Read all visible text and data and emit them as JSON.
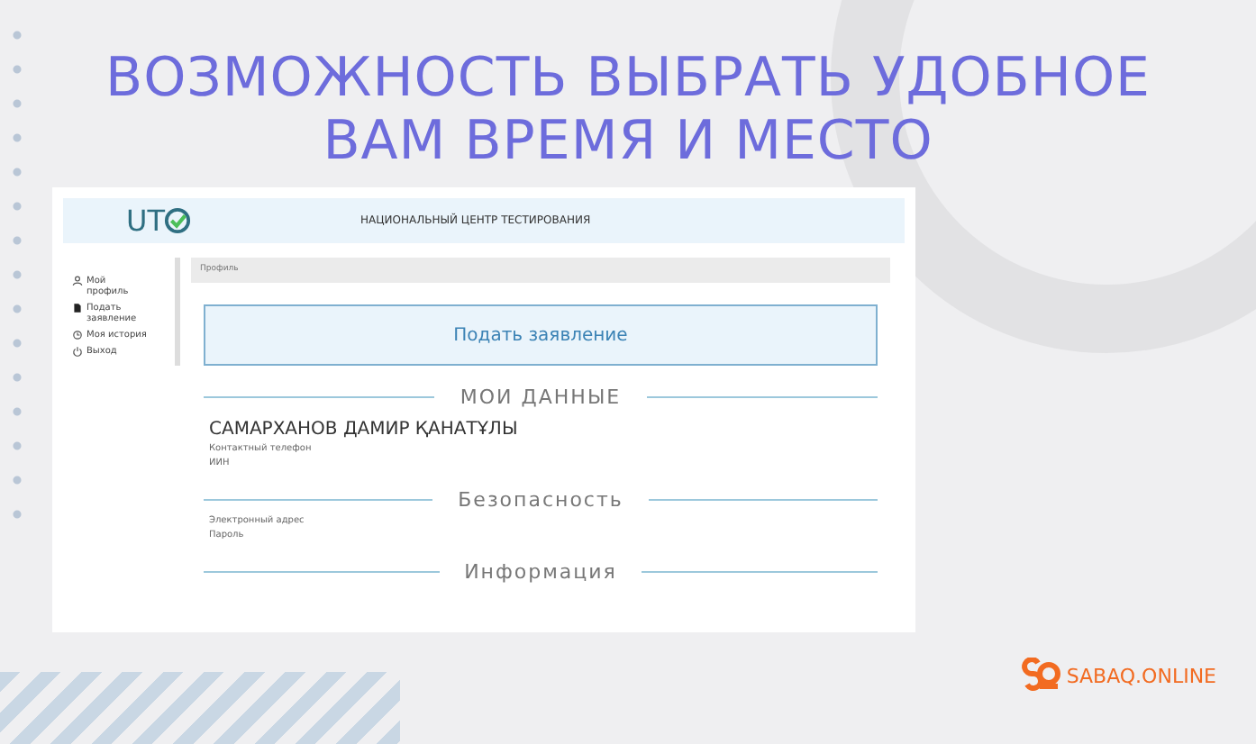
{
  "slide": {
    "title_lines": [
      "ВОЗМОЖНОСТЬ ВЫБРАТЬ УДОБНОЕ",
      "ВАМ ВРЕМЯ И МЕСТО"
    ]
  },
  "app": {
    "logo": "UT",
    "header_title": "НАЦИОНАЛЬНЫЙ ЦЕНТР ТЕСТИРОВАНИЯ",
    "sidebar": {
      "items": [
        {
          "kind": "profile",
          "label": "Мой профиль"
        },
        {
          "kind": "document",
          "label": "Подать заявление"
        },
        {
          "kind": "history",
          "label": "Моя история"
        },
        {
          "kind": "logout",
          "label": "Выход"
        }
      ]
    },
    "breadcrumb": "Профиль",
    "apply_button": "Подать заявление",
    "sections": [
      {
        "heading": "МОИ ДАННЫЕ",
        "name": "САМАРХАНОВ ДАМИР ҚАНАТҰЛЫ",
        "fields": [
          "Контактный телефон",
          "ИИН"
        ]
      },
      {
        "heading": "Безопасность",
        "fields": [
          "Электронный адрес",
          "Пароль"
        ]
      },
      {
        "heading": "Информация"
      }
    ]
  },
  "brand": {
    "name": "SABAQ.ONLINE"
  }
}
